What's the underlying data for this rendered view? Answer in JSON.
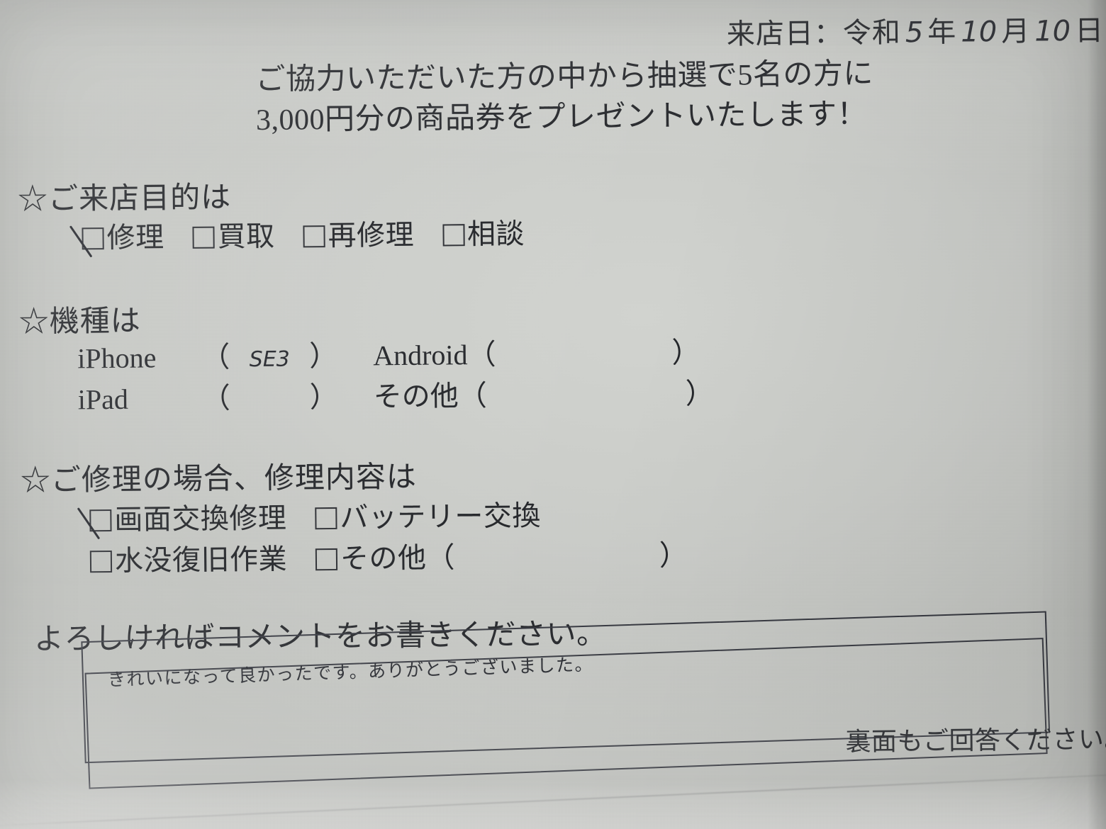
{
  "document": {
    "type": "customer-survey-form",
    "language": "ja"
  },
  "date_line": {
    "label": "来店日：令和",
    "era_year_value": "5",
    "year_unit": "年",
    "month_value": "10",
    "month_unit": "月",
    "day_value": "10",
    "day_unit": "日"
  },
  "header": {
    "line1": "ご協力いただいた方の中から抽選で5名の方に",
    "line2": "3,000円分の商品券をプレゼントいたします！"
  },
  "sections": {
    "purpose": {
      "marker": "☆",
      "heading": "ご来店目的は",
      "options": [
        {
          "label": "修理",
          "checked": true
        },
        {
          "label": "買取",
          "checked": false
        },
        {
          "label": "再修理",
          "checked": false
        },
        {
          "label": "相談",
          "checked": false
        }
      ]
    },
    "device": {
      "marker": "☆",
      "heading": "機種は",
      "rows": [
        {
          "left": {
            "label": "iPhone",
            "open": "（",
            "value": "SE3",
            "close": "）"
          },
          "right": {
            "label": "Android",
            "open": "（",
            "value": "",
            "close": "）"
          }
        },
        {
          "left": {
            "label": "iPad",
            "open": "（",
            "value": "",
            "close": "）"
          },
          "right": {
            "label": "その他",
            "open": "（",
            "value": "",
            "close": "）"
          }
        }
      ]
    },
    "repair": {
      "marker": "☆",
      "heading": "ご修理の場合、修理内容は",
      "row1": [
        {
          "label": "画面交換修理",
          "checked": true
        },
        {
          "label": "バッテリー交換",
          "checked": false
        }
      ],
      "row2": [
        {
          "label": "水没復旧作業",
          "checked": false
        },
        {
          "label": "その他（",
          "checked": false,
          "trailing_paren": "）"
        }
      ]
    }
  },
  "comment": {
    "prompt": "よろしければコメントをお書きください。",
    "handwritten_value": "きれいになって良かったです。ありがとうございました。",
    "placeholder": ""
  },
  "footer": {
    "back_note": "裏面もご回答ください。"
  },
  "colors": {
    "paper": "#cbcdc9",
    "ink": "#222428",
    "handwriting": "#22242a",
    "box_border": "#32343c"
  }
}
